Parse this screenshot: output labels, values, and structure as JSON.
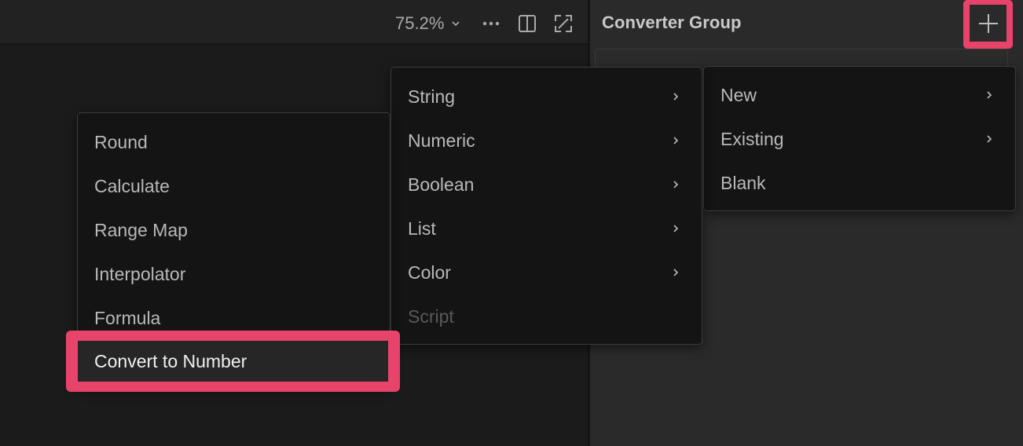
{
  "toolbar": {
    "zoom_value": "75.2%",
    "icons": [
      "chevron-down-icon",
      "more-icon",
      "split-view-icon",
      "expand-icon"
    ]
  },
  "panel": {
    "title": "Converter Group",
    "add_icon": "plus-icon"
  },
  "menus": {
    "left": {
      "items": [
        {
          "label": "Round"
        },
        {
          "label": "Calculate"
        },
        {
          "label": "Range Map"
        },
        {
          "label": "Interpolator"
        },
        {
          "label": "Formula"
        },
        {
          "label": "Convert to Number",
          "highlighted": true
        }
      ]
    },
    "middle": {
      "items": [
        {
          "label": "String",
          "submenu": true
        },
        {
          "label": "Numeric",
          "submenu": true
        },
        {
          "label": "Boolean",
          "submenu": true
        },
        {
          "label": "List",
          "submenu": true
        },
        {
          "label": "Color",
          "submenu": true
        },
        {
          "label": "Script",
          "disabled": true
        }
      ]
    },
    "right": {
      "items": [
        {
          "label": "New",
          "submenu": true
        },
        {
          "label": "Existing",
          "submenu": true
        },
        {
          "label": "Blank"
        }
      ]
    }
  },
  "colors": {
    "highlight": "#e8436b",
    "menu_bg": "#141414",
    "panel_bg": "#2a2a2a",
    "text": "#b9b9b9",
    "disabled_text": "#5a5a5a"
  }
}
